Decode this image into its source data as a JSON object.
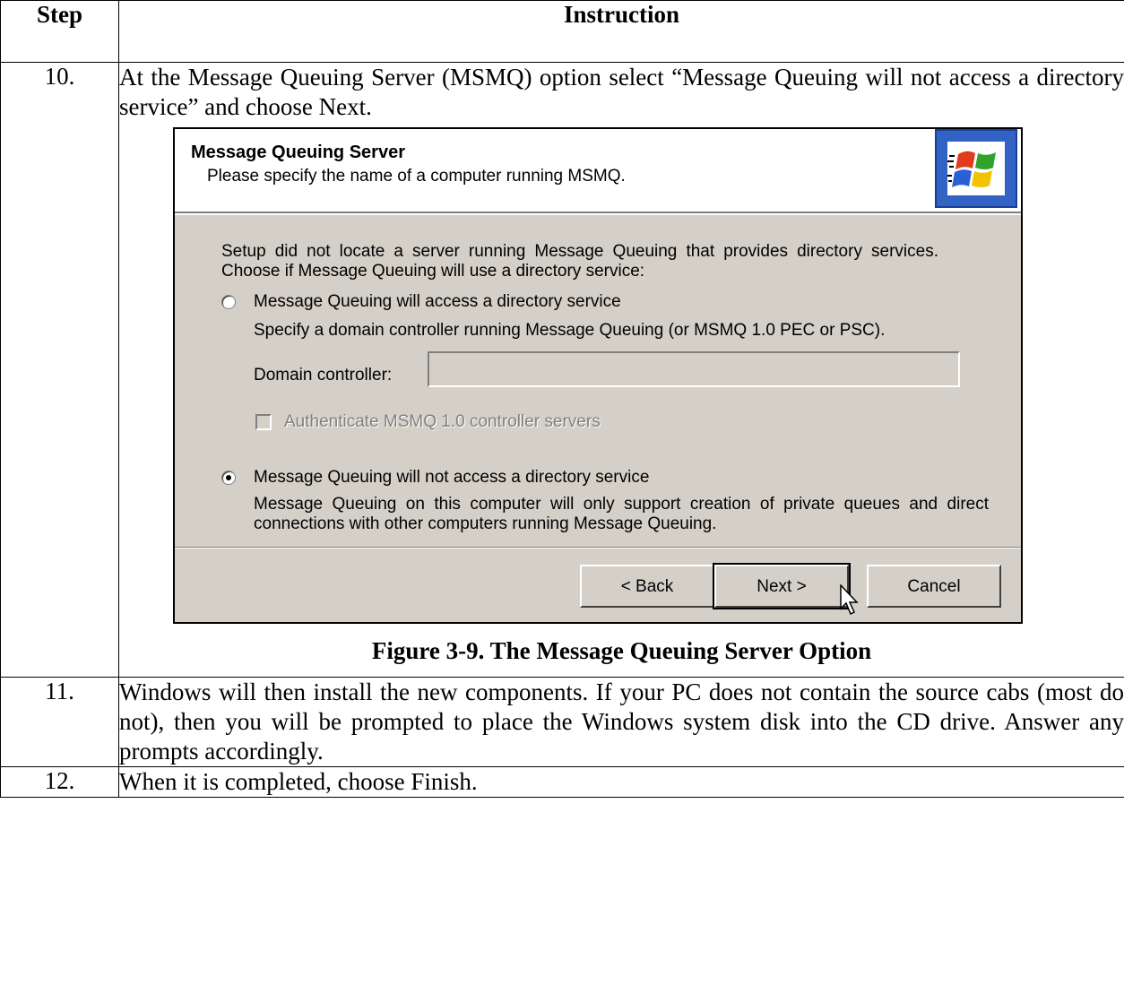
{
  "table": {
    "headers": {
      "step": "Step",
      "instruction": "Instruction"
    },
    "rows": [
      {
        "step": "10.",
        "instruction": "At the Message Queuing Server (MSMQ) option select “Message Queuing will not access a directory service” and choose Next."
      },
      {
        "step": "11.",
        "instruction": "Windows will then install the new components.  If your PC does not contain the source cabs (most do not), then you will be prompted to place the Windows system disk into the CD drive.  Answer any prompts accordingly."
      },
      {
        "step": "12.",
        "instruction": "When it is completed, choose Finish."
      }
    ]
  },
  "dialog": {
    "title": "Message Queuing Server",
    "subtitle": "Please specify the name of a computer running MSMQ.",
    "intro": "Setup did not locate a server running Message Queuing that provides directory services. Choose if Message Queuing will use a directory service:",
    "option_access": {
      "label": "Message Queuing will access a directory service",
      "description": "Specify a domain controller running Message Queuing (or MSMQ 1.0 PEC or PSC).",
      "selected": false
    },
    "domain_controller": {
      "label": "Domain controller:",
      "value": ""
    },
    "authenticate_checkbox": {
      "label": "Authenticate MSMQ 1.0 controller servers",
      "checked": false,
      "enabled": false
    },
    "option_no_access": {
      "label": "Message Queuing will not access a directory service",
      "description": "Message Queuing on this computer will only support creation of private queues and direct connections with other computers running Message Queuing.",
      "selected": true
    },
    "buttons": {
      "back": "< Back",
      "next": "Next >",
      "cancel": "Cancel"
    }
  },
  "figure_caption": "Figure 3-9.  The Message Queuing Server Option",
  "colors": {
    "dialog_face": "#d4d0c8",
    "logo_blue": "#3162c4"
  },
  "icons": {
    "logo": "windows-logo-icon",
    "cursor": "mouse-pointer-icon"
  }
}
